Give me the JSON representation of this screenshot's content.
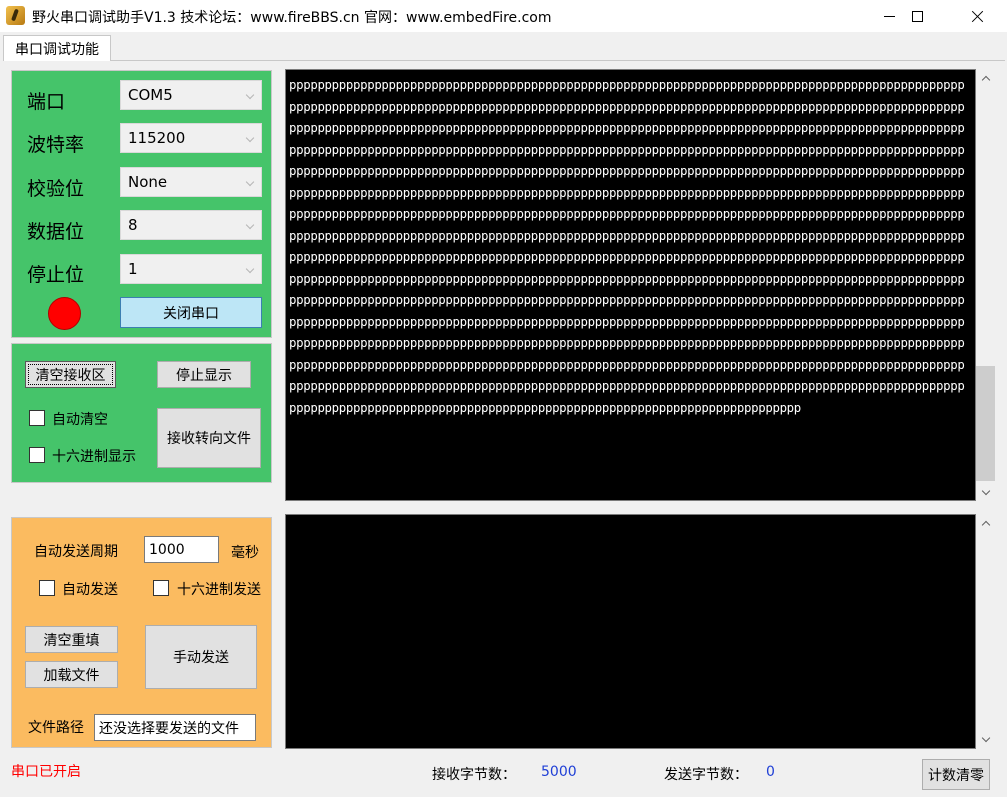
{
  "window": {
    "title": "野火串口调试助手V1.3    技术论坛：www.fireBBS.cn    官网：www.embedFire.com"
  },
  "tab": {
    "label": "串口调试功能"
  },
  "port_settings": {
    "port_label": "端口",
    "port_value": "COM5",
    "baud_label": "波特率",
    "baud_value": "115200",
    "parity_label": "校验位",
    "parity_value": "None",
    "databits_label": "数据位",
    "databits_value": "8",
    "stopbits_label": "停止位",
    "stopbits_value": "1",
    "status_led_color": "#ff0000",
    "toggle_button": "关闭串口"
  },
  "receive_controls": {
    "clear_button": "清空接收区",
    "stop_display_button": "停止显示",
    "auto_clear_label": "自动清空",
    "hex_display_label": "十六进制显示",
    "redirect_button": "接收转向文件"
  },
  "send_controls": {
    "period_label": "自动发送周期",
    "period_value": "1000",
    "period_unit": "毫秒",
    "auto_send_label": "自动发送",
    "hex_send_label": "十六进制发送",
    "clear_refill_button": "清空重填",
    "load_file_button": "加载文件",
    "manual_send_button": "手动发送",
    "file_path_label": "文件路径",
    "file_path_value": "还没选择要发送的文件"
  },
  "receive_area": {
    "content": ""
  },
  "status_bar": {
    "port_status": "串口已开启",
    "rx_label": "接收字节数：",
    "rx_count": "5000",
    "tx_label": "发送字节数：",
    "tx_count": "0",
    "reset_count_button": "计数清零"
  },
  "colors": {
    "port_panel": "#45c46a",
    "send_panel": "#fbbb60",
    "status_red": "#ff0000",
    "count_blue": "#1f3fd6"
  }
}
